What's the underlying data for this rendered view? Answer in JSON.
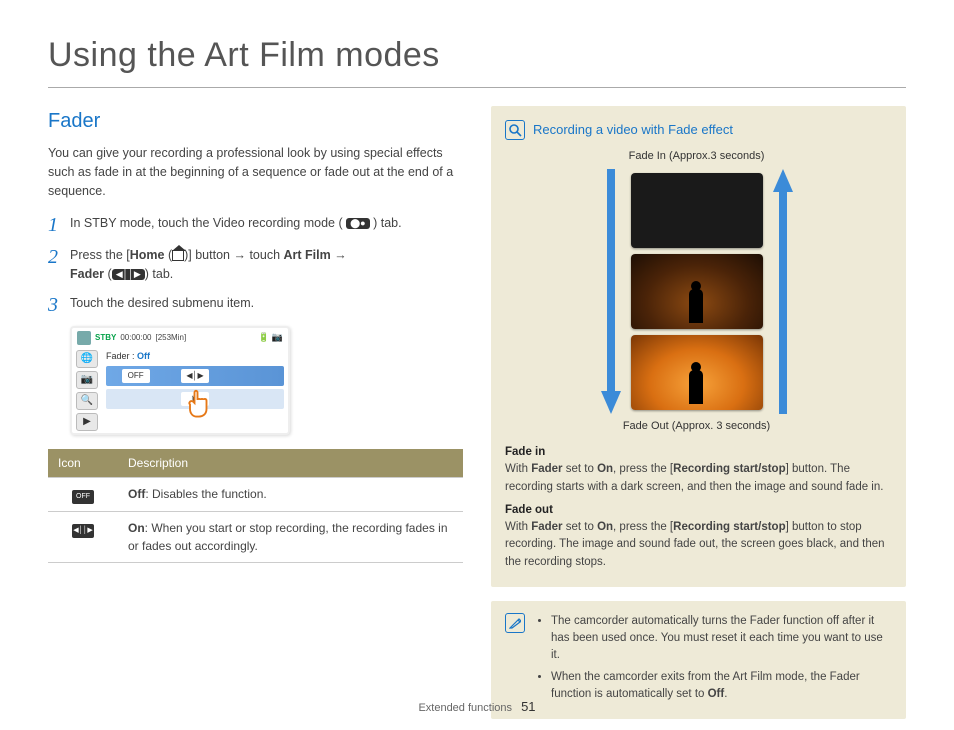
{
  "page_title": "Using the Art Film modes",
  "section_title": "Fader",
  "intro": "You can give your recording a professional look by using special effects such as fade in at the beginning of a sequence or fade out at the end of a sequence.",
  "steps": {
    "s1_a": "In STBY mode, touch the Video recording mode (",
    "s1_b": ") tab.",
    "s2_a": "Press the [",
    "s2_home": "Home",
    "s2_b": " (",
    "s2_c": ")] button ",
    "s2_arrow1": "→",
    "s2_d": " touch ",
    "s2_artfilm": "Art Film",
    "s2_arrow2": " →",
    "s2_fader": "Fader",
    "s2_e": " (",
    "s2_f": ") tab.",
    "s3": "Touch the desired submenu item."
  },
  "screenshot": {
    "stby": "STBY",
    "time": "00:00:00",
    "remain": "[253Min]",
    "label": "Fader :",
    "value": "Off"
  },
  "table": {
    "h1": "Icon",
    "h2": "Description",
    "r1_b": "Off",
    "r1_t": ": Disables the function.",
    "r2_b": "On",
    "r2_t": ": When you start or stop recording, the recording fades in or fades out accordingly."
  },
  "panel": {
    "title": "Recording a video with Fade effect",
    "cap_in": "Fade In (Approx.3 seconds)",
    "cap_out": "Fade Out (Approx. 3 seconds)",
    "fi_head": "Fade in",
    "fi_a": "With ",
    "fi_b": "Fader",
    "fi_c": " set to ",
    "fi_d": "On",
    "fi_e": ", press the [",
    "fi_f": "Recording start/stop",
    "fi_g": "] button. The recording starts with a dark screen, and then the image and sound fade in.",
    "fo_head": "Fade out",
    "fo_a": "With ",
    "fo_b": "Fader",
    "fo_c": " set to ",
    "fo_d": "On",
    "fo_e": ", press the [",
    "fo_f": "Recording start/stop",
    "fo_g": "] button to stop recording. The image and sound fade out, the screen goes black, and then the recording stops."
  },
  "notes": {
    "n1": "The camcorder automatically turns the Fader function off after it has been used once. You must reset it each time you want to use it.",
    "n2_a": "When the camcorder exits from the Art Film mode, the Fader function is automatically set to ",
    "n2_b": "Off",
    "n2_c": "."
  },
  "footer_label": "Extended functions",
  "footer_page": "51"
}
